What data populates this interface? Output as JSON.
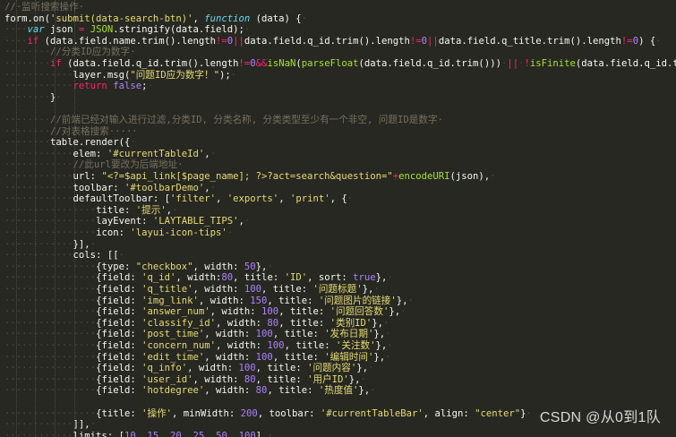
{
  "editor": {
    "lines": [
      [
        [
          "comment",
          "//·监听搜索操作·"
        ]
      ],
      [
        [
          "plain",
          "form.on("
        ],
        [
          "string",
          "'submit(data-search-btn)'"
        ],
        [
          "plain",
          ", "
        ],
        [
          "storage",
          "function"
        ],
        [
          "plain",
          " (data) {"
        ],
        [
          "ws",
          "·"
        ]
      ],
      [
        [
          "ws",
          "····"
        ],
        [
          "storage",
          "var"
        ],
        [
          "plain",
          " json "
        ],
        [
          "keyword",
          "="
        ],
        [
          "plain",
          " "
        ],
        [
          "func",
          "JSON"
        ],
        [
          "plain",
          ".stringify(data.field);"
        ],
        [
          "ws",
          "·"
        ]
      ],
      [
        [
          "ws",
          "····"
        ],
        [
          "keyword",
          "if"
        ],
        [
          "plain",
          " (data.field.name.trim().length"
        ],
        [
          "keyword",
          "!="
        ],
        [
          "number",
          "0"
        ],
        [
          "keyword",
          "||"
        ],
        [
          "plain",
          "data.field.q_id.trim().length"
        ],
        [
          "keyword",
          "!="
        ],
        [
          "number",
          "0"
        ],
        [
          "keyword",
          "||"
        ],
        [
          "plain",
          "data.field.q_title.trim().length"
        ],
        [
          "keyword",
          "!="
        ],
        [
          "number",
          "0"
        ],
        [
          "plain",
          ") {"
        ],
        [
          "ws",
          "·"
        ]
      ],
      [
        [
          "ws",
          "········"
        ],
        [
          "comment",
          "//分类ID应为数字·"
        ]
      ],
      [
        [
          "ws",
          "········"
        ],
        [
          "keyword",
          "if"
        ],
        [
          "plain",
          " (data.field.q_id.trim().length"
        ],
        [
          "keyword",
          "!="
        ],
        [
          "number",
          "0"
        ],
        [
          "keyword",
          "&&"
        ],
        [
          "func",
          "isNaN"
        ],
        [
          "plain",
          "("
        ],
        [
          "func",
          "parseFloat"
        ],
        [
          "plain",
          "(data.field.q_id.trim()))"
        ],
        [
          "ws",
          "·"
        ],
        [
          "keyword",
          "||"
        ],
        [
          "ws",
          "·"
        ],
        [
          "keyword",
          "!"
        ],
        [
          "func",
          "isFinite"
        ],
        [
          "plain",
          "(data.field.q_id.trim())) {"
        ],
        [
          "ws",
          "·"
        ]
      ],
      [
        [
          "ws",
          "············"
        ],
        [
          "plain",
          "layer.msg("
        ],
        [
          "string",
          "\"问题ID应为数字！\""
        ],
        [
          "plain",
          ");"
        ],
        [
          "ws",
          "·"
        ]
      ],
      [
        [
          "ws",
          "············"
        ],
        [
          "keyword",
          "return"
        ],
        [
          "plain",
          " "
        ],
        [
          "number",
          "false"
        ],
        [
          "plain",
          ";"
        ],
        [
          "ws",
          "·"
        ]
      ],
      [
        [
          "ws",
          "········"
        ],
        [
          "plain",
          "}"
        ],
        [
          "ws",
          "·"
        ]
      ],
      [],
      [
        [
          "ws",
          "········"
        ],
        [
          "comment",
          "//前端已经对输入进行过滤,分类ID, 分类名称, 分类类型至少有一个非空, 问题ID是数字·"
        ]
      ],
      [
        [
          "ws",
          "········"
        ],
        [
          "comment",
          "//对表格搜索·····"
        ]
      ],
      [
        [
          "ws",
          "········"
        ],
        [
          "plain",
          "table.render({"
        ],
        [
          "ws",
          "·"
        ]
      ],
      [
        [
          "ws",
          "············"
        ],
        [
          "plain",
          "elem: "
        ],
        [
          "string",
          "'#currentTableId'"
        ],
        [
          "plain",
          ","
        ],
        [
          "ws",
          "·"
        ]
      ],
      [
        [
          "ws",
          "············"
        ],
        [
          "comment",
          "//此url要改为后端地址·"
        ]
      ],
      [
        [
          "ws",
          "············"
        ],
        [
          "plain",
          "url: "
        ],
        [
          "string",
          "\"<?=$api_link[$page_name]; ?>?act=search&question=\""
        ],
        [
          "keyword",
          "+"
        ],
        [
          "func",
          "encodeURI"
        ],
        [
          "plain",
          "(json),"
        ],
        [
          "ws",
          "·"
        ]
      ],
      [
        [
          "ws",
          "············"
        ],
        [
          "plain",
          "toolbar: "
        ],
        [
          "string",
          "'#toolbarDemo'"
        ],
        [
          "plain",
          ","
        ],
        [
          "ws",
          "·"
        ]
      ],
      [
        [
          "ws",
          "············"
        ],
        [
          "plain",
          "defaultToolbar: ["
        ],
        [
          "string",
          "'filter'"
        ],
        [
          "plain",
          ", "
        ],
        [
          "string",
          "'exports'"
        ],
        [
          "plain",
          ", "
        ],
        [
          "string",
          "'print'"
        ],
        [
          "plain",
          ", {"
        ],
        [
          "ws",
          "·"
        ]
      ],
      [
        [
          "ws",
          "················"
        ],
        [
          "plain",
          "title: "
        ],
        [
          "string",
          "'提示'"
        ],
        [
          "plain",
          ","
        ],
        [
          "ws",
          "·"
        ]
      ],
      [
        [
          "ws",
          "················"
        ],
        [
          "plain",
          "layEvent: "
        ],
        [
          "string",
          "'LAYTABLE_TIPS'"
        ],
        [
          "plain",
          ","
        ],
        [
          "ws",
          "·"
        ]
      ],
      [
        [
          "ws",
          "················"
        ],
        [
          "plain",
          "icon: "
        ],
        [
          "string",
          "'layui-icon-tips'"
        ],
        [
          "ws",
          "·"
        ]
      ],
      [
        [
          "ws",
          "············"
        ],
        [
          "plain",
          "}],"
        ],
        [
          "ws",
          "·"
        ]
      ],
      [
        [
          "ws",
          "············"
        ],
        [
          "plain",
          "cols: [["
        ],
        [
          "ws",
          "·"
        ]
      ],
      [
        [
          "ws",
          "················"
        ],
        [
          "plain",
          "{type: "
        ],
        [
          "string",
          "\"checkbox\""
        ],
        [
          "plain",
          ", width: "
        ],
        [
          "number",
          "50"
        ],
        [
          "plain",
          "},"
        ],
        [
          "ws",
          "·"
        ]
      ],
      [
        [
          "ws",
          "················"
        ],
        [
          "plain",
          "{field: "
        ],
        [
          "string",
          "'q_id'"
        ],
        [
          "plain",
          ", width:"
        ],
        [
          "number",
          "80"
        ],
        [
          "plain",
          ", title: "
        ],
        [
          "string",
          "'ID'"
        ],
        [
          "plain",
          ", sort: "
        ],
        [
          "number",
          "true"
        ],
        [
          "plain",
          "},"
        ],
        [
          "ws",
          "·"
        ]
      ],
      [
        [
          "ws",
          "················"
        ],
        [
          "plain",
          "{field: "
        ],
        [
          "string",
          "'q_title'"
        ],
        [
          "plain",
          ", width: "
        ],
        [
          "number",
          "100"
        ],
        [
          "plain",
          ", title: "
        ],
        [
          "string",
          "'问题标题'"
        ],
        [
          "plain",
          "},"
        ],
        [
          "ws",
          "·"
        ]
      ],
      [
        [
          "ws",
          "················"
        ],
        [
          "plain",
          "{field: "
        ],
        [
          "string",
          "'img_link'"
        ],
        [
          "plain",
          ", width: "
        ],
        [
          "number",
          "150"
        ],
        [
          "plain",
          ", title: "
        ],
        [
          "string",
          "'问题图片的链接'"
        ],
        [
          "plain",
          "},"
        ],
        [
          "ws",
          "·"
        ]
      ],
      [
        [
          "ws",
          "················"
        ],
        [
          "plain",
          "{field: "
        ],
        [
          "string",
          "'answer_num'"
        ],
        [
          "plain",
          ", width: "
        ],
        [
          "number",
          "100"
        ],
        [
          "plain",
          ", title: "
        ],
        [
          "string",
          "'问题回答数'"
        ],
        [
          "plain",
          "},"
        ],
        [
          "ws",
          "·"
        ]
      ],
      [
        [
          "ws",
          "················"
        ],
        [
          "plain",
          "{field: "
        ],
        [
          "string",
          "'classify_id'"
        ],
        [
          "plain",
          ", width: "
        ],
        [
          "number",
          "80"
        ],
        [
          "plain",
          ", title: "
        ],
        [
          "string",
          "'类别ID'"
        ],
        [
          "plain",
          "},"
        ],
        [
          "ws",
          "·"
        ]
      ],
      [
        [
          "ws",
          "················"
        ],
        [
          "plain",
          "{field: "
        ],
        [
          "string",
          "'post_time'"
        ],
        [
          "plain",
          ", width: "
        ],
        [
          "number",
          "100"
        ],
        [
          "plain",
          ", title: "
        ],
        [
          "string",
          "'发布日期'"
        ],
        [
          "plain",
          "},"
        ],
        [
          "ws",
          "·"
        ]
      ],
      [
        [
          "ws",
          "················"
        ],
        [
          "plain",
          "{field: "
        ],
        [
          "string",
          "'concern_num'"
        ],
        [
          "plain",
          ", width: "
        ],
        [
          "number",
          "100"
        ],
        [
          "plain",
          ", title: "
        ],
        [
          "string",
          "'关注数'"
        ],
        [
          "plain",
          "},"
        ],
        [
          "ws",
          "·"
        ]
      ],
      [
        [
          "ws",
          "················"
        ],
        [
          "plain",
          "{field: "
        ],
        [
          "string",
          "'edit_time'"
        ],
        [
          "plain",
          ", width: "
        ],
        [
          "number",
          "100"
        ],
        [
          "plain",
          ", title: "
        ],
        [
          "string",
          "'编辑时间'"
        ],
        [
          "plain",
          "},"
        ],
        [
          "ws",
          "·"
        ]
      ],
      [
        [
          "ws",
          "················"
        ],
        [
          "plain",
          "{field: "
        ],
        [
          "string",
          "'q_info'"
        ],
        [
          "plain",
          ", width: "
        ],
        [
          "number",
          "100"
        ],
        [
          "plain",
          ", title: "
        ],
        [
          "string",
          "'问题内容'"
        ],
        [
          "plain",
          "},"
        ],
        [
          "ws",
          "·"
        ]
      ],
      [
        [
          "ws",
          "················"
        ],
        [
          "plain",
          "{field: "
        ],
        [
          "string",
          "'user_id'"
        ],
        [
          "plain",
          ", width: "
        ],
        [
          "number",
          "80"
        ],
        [
          "plain",
          ", title: "
        ],
        [
          "string",
          "'用户ID'"
        ],
        [
          "plain",
          "},"
        ],
        [
          "ws",
          "·"
        ]
      ],
      [
        [
          "ws",
          "················"
        ],
        [
          "plain",
          "{field: "
        ],
        [
          "string",
          "'hotdegree'"
        ],
        [
          "plain",
          ", width: "
        ],
        [
          "number",
          "80"
        ],
        [
          "plain",
          ", title: "
        ],
        [
          "string",
          "'热度值'"
        ],
        [
          "plain",
          "},"
        ],
        [
          "ws",
          "·"
        ]
      ],
      [],
      [
        [
          "ws",
          "················"
        ],
        [
          "plain",
          "{title: "
        ],
        [
          "string",
          "'操作'"
        ],
        [
          "plain",
          ", minWidth: "
        ],
        [
          "number",
          "200"
        ],
        [
          "plain",
          ", toolbar: "
        ],
        [
          "string",
          "'#currentTableBar'"
        ],
        [
          "plain",
          ", align: "
        ],
        [
          "string",
          "\"center\""
        ],
        [
          "plain",
          "}"
        ],
        [
          "ws",
          "·"
        ]
      ],
      [
        [
          "ws",
          "············"
        ],
        [
          "plain",
          "]],"
        ],
        [
          "ws",
          "·"
        ]
      ],
      [
        [
          "ws",
          "············"
        ],
        [
          "plain",
          "limits: ["
        ],
        [
          "number",
          "10"
        ],
        [
          "plain",
          ", "
        ],
        [
          "number",
          "15"
        ],
        [
          "plain",
          ", "
        ],
        [
          "number",
          "20"
        ],
        [
          "plain",
          ", "
        ],
        [
          "number",
          "25"
        ],
        [
          "plain",
          ", "
        ],
        [
          "number",
          "50"
        ],
        [
          "plain",
          ", "
        ],
        [
          "number",
          "100"
        ],
        [
          "plain",
          "],"
        ],
        [
          "ws",
          "·"
        ]
      ]
    ]
  },
  "watermark": "CSDN @从0到1队",
  "colors": {
    "background": "#272822",
    "comment": "#75715e",
    "keyword": "#f92672",
    "storage": "#66d9ef",
    "string": "#e6db74",
    "number": "#ae81ff",
    "function": "#a6e22e",
    "text": "#f8f8f2"
  }
}
